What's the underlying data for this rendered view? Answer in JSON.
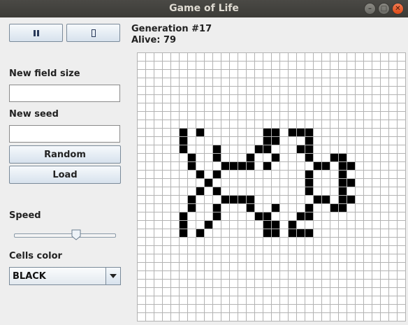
{
  "window": {
    "title": "Game of Life"
  },
  "controls": {
    "pause_icon": "pause-icon",
    "step_icon": "step-icon"
  },
  "status": {
    "generation": "Generation #17",
    "alive": "Alive: 79"
  },
  "field_size": {
    "label": "New field size",
    "value": ""
  },
  "seed": {
    "label": "New seed",
    "value": ""
  },
  "buttons": {
    "random": "Random",
    "load": "Load"
  },
  "speed": {
    "label": "Speed",
    "level": 0.62
  },
  "cells_color": {
    "label": "Cells color",
    "selected": "BLACK"
  },
  "board": {
    "columns": 32,
    "rows": 32,
    "cell_color": "#000000",
    "grid_color": "#b3b3b3",
    "alive_cells": [
      [
        5,
        9
      ],
      [
        7,
        9
      ],
      [
        15,
        9
      ],
      [
        16,
        9
      ],
      [
        18,
        9
      ],
      [
        19,
        9
      ],
      [
        20,
        9
      ],
      [
        5,
        10
      ],
      [
        15,
        10
      ],
      [
        16,
        10
      ],
      [
        20,
        10
      ],
      [
        5,
        11
      ],
      [
        9,
        11
      ],
      [
        14,
        11
      ],
      [
        15,
        11
      ],
      [
        19,
        11
      ],
      [
        20,
        11
      ],
      [
        6,
        12
      ],
      [
        9,
        12
      ],
      [
        13,
        12
      ],
      [
        16,
        12
      ],
      [
        20,
        12
      ],
      [
        23,
        12
      ],
      [
        24,
        12
      ],
      [
        6,
        13
      ],
      [
        10,
        13
      ],
      [
        11,
        13
      ],
      [
        12,
        13
      ],
      [
        13,
        13
      ],
      [
        15,
        13
      ],
      [
        21,
        13
      ],
      [
        22,
        13
      ],
      [
        24,
        13
      ],
      [
        25,
        13
      ],
      [
        7,
        14
      ],
      [
        9,
        14
      ],
      [
        20,
        14
      ],
      [
        24,
        14
      ],
      [
        8,
        15
      ],
      [
        20,
        15
      ],
      [
        24,
        15
      ],
      [
        25,
        15
      ],
      [
        7,
        16
      ],
      [
        9,
        16
      ],
      [
        20,
        16
      ],
      [
        24,
        16
      ],
      [
        6,
        17
      ],
      [
        10,
        17
      ],
      [
        11,
        17
      ],
      [
        12,
        17
      ],
      [
        13,
        17
      ],
      [
        21,
        17
      ],
      [
        22,
        17
      ],
      [
        24,
        17
      ],
      [
        25,
        17
      ],
      [
        6,
        18
      ],
      [
        9,
        18
      ],
      [
        13,
        18
      ],
      [
        16,
        18
      ],
      [
        20,
        18
      ],
      [
        23,
        18
      ],
      [
        24,
        18
      ],
      [
        5,
        19
      ],
      [
        9,
        19
      ],
      [
        14,
        19
      ],
      [
        15,
        19
      ],
      [
        19,
        19
      ],
      [
        20,
        19
      ],
      [
        5,
        20
      ],
      [
        8,
        20
      ],
      [
        15,
        20
      ],
      [
        16,
        20
      ],
      [
        18,
        20
      ],
      [
        5,
        21
      ],
      [
        7,
        21
      ],
      [
        15,
        21
      ],
      [
        16,
        21
      ],
      [
        18,
        21
      ],
      [
        19,
        21
      ],
      [
        20,
        21
      ]
    ]
  }
}
